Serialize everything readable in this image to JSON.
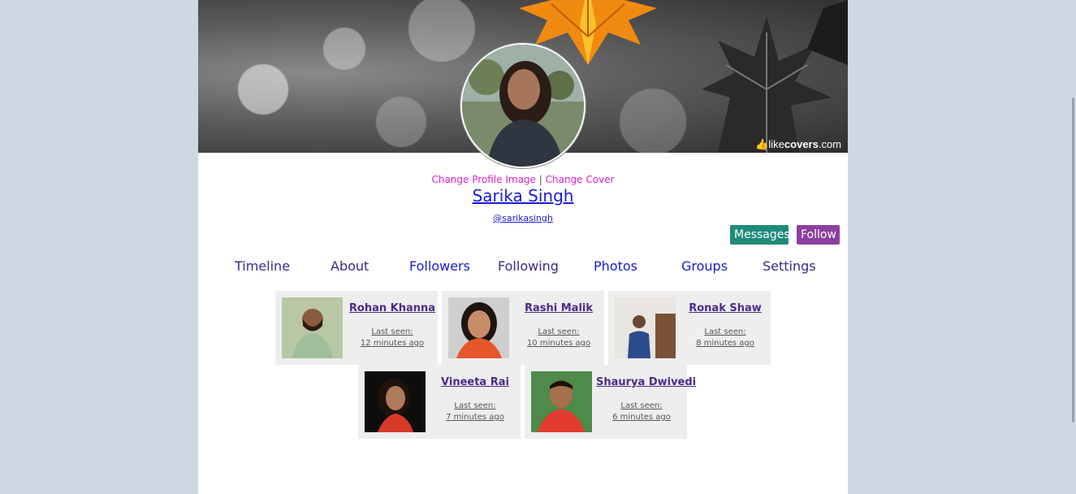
{
  "cover": {
    "watermark_prefix": "like",
    "watermark_brand": "covers",
    "watermark_suffix": ".com"
  },
  "profile": {
    "change_image_label": "Change Profile Image",
    "separator": "|",
    "change_cover_label": "Change Cover",
    "name": "Sarika Singh",
    "handle": "@sarikasingh"
  },
  "actions": {
    "messages_label": "Messages",
    "follow_label": "Follow"
  },
  "nav": {
    "items": [
      "Timeline",
      "About",
      "Followers",
      "Following",
      "Photos",
      "Groups",
      "Settings"
    ]
  },
  "followers": [
    {
      "name": "Rohan Khanna",
      "seen_label": "Last seen:",
      "seen_time": "12 minutes ago"
    },
    {
      "name": "Rashi Malik",
      "seen_label": "Last seen:",
      "seen_time": "10 minutes ago"
    },
    {
      "name": "Ronak Shaw",
      "seen_label": "Last seen:",
      "seen_time": "8 minutes ago"
    },
    {
      "name": "Vineeta Rai",
      "seen_label": "Last seen:",
      "seen_time": "7 minutes ago"
    },
    {
      "name": "Shaurya Dwivedi",
      "seen_label": "Last seen:",
      "seen_time": "6 minutes ago"
    }
  ],
  "colors": {
    "page_bg": "#cfd7e3",
    "link_blue": "#1a1ae0",
    "change_links": "#e020d0",
    "messages_btn": "#1f8b79",
    "follow_btn": "#8c3fa0",
    "card_bg": "#eeeeee"
  }
}
